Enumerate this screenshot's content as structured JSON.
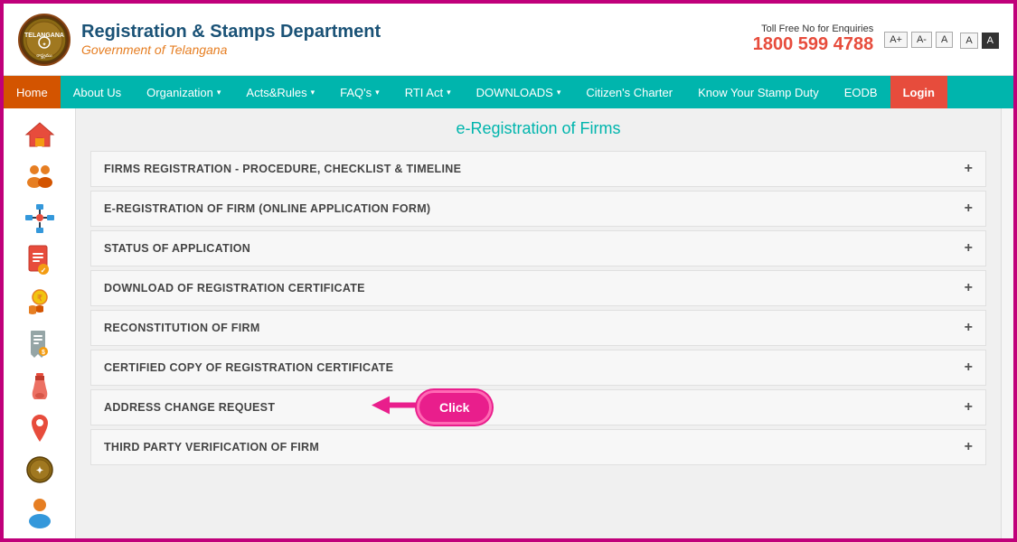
{
  "header": {
    "dept_title": "Registration & Stamps Department",
    "dept_subtitle": "Government of Telangana",
    "toll_free_label": "Toll Free No for Enquiries",
    "toll_free_number": "1800 599 4788",
    "font_controls": [
      "A+",
      "A-",
      "A",
      "A",
      "A"
    ]
  },
  "navbar": {
    "items": [
      {
        "label": "Home",
        "active": true,
        "has_chevron": false
      },
      {
        "label": "About Us",
        "active": false,
        "has_chevron": false
      },
      {
        "label": "Organization",
        "active": false,
        "has_chevron": true
      },
      {
        "label": "Acts&Rules",
        "active": false,
        "has_chevron": true
      },
      {
        "label": "FAQ's",
        "active": false,
        "has_chevron": true
      },
      {
        "label": "RTI Act",
        "active": false,
        "has_chevron": true
      },
      {
        "label": "DOWNLOADS",
        "active": false,
        "has_chevron": true
      },
      {
        "label": "Citizen's Charter",
        "active": false,
        "has_chevron": false
      },
      {
        "label": "Know Your Stamp Duty",
        "active": false,
        "has_chevron": false
      },
      {
        "label": "EODB",
        "active": false,
        "has_chevron": false
      },
      {
        "label": "Login",
        "active": false,
        "has_chevron": false,
        "is_login": true
      }
    ]
  },
  "page_title": "e-Registration of Firms",
  "accordion": {
    "items": [
      {
        "label": "FIRMS REGISTRATION - PROCEDURE, CHECKLIST & TIMELINE",
        "has_click": false
      },
      {
        "label": "E-REGISTRATION OF FIRM (ONLINE APPLICATION FORM)",
        "has_click": false
      },
      {
        "label": "STATUS OF APPLICATION",
        "has_click": false
      },
      {
        "label": "DOWNLOAD OF REGISTRATION CERTIFICATE",
        "has_click": false
      },
      {
        "label": "RECONSTITUTION OF FIRM",
        "has_click": false
      },
      {
        "label": "CERTIFIED COPY OF REGISTRATION CERTIFICATE",
        "has_click": false
      },
      {
        "label": "ADDRESS CHANGE REQUEST",
        "has_click": true
      },
      {
        "label": "THIRD PARTY VERIFICATION OF FIRM",
        "has_click": false
      }
    ],
    "click_label": "Click"
  },
  "sidebar": {
    "icons": [
      "home-icon",
      "people-icon",
      "network-icon",
      "document-icon",
      "coin-icon",
      "receipt-icon",
      "bottle-icon",
      "pin-icon",
      "emblem-icon",
      "person-icon"
    ]
  }
}
